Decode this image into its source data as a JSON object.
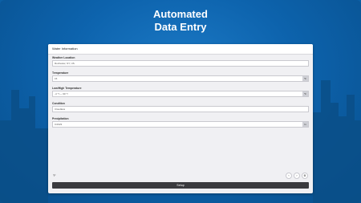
{
  "hero": {
    "line1": "Automated",
    "line2": "Data Entry"
  },
  "window": {
    "title": "Water Information"
  },
  "fields": [
    {
      "label": "Weather Location",
      "value": "Rochester, NY, US",
      "unit": ""
    },
    {
      "label": "Temperature",
      "value": "15",
      "unit": "°F"
    },
    {
      "label": "Low/High Temperature",
      "value": "-4 °f — 90 °f",
      "unit": "°F"
    },
    {
      "label": "Condition",
      "value": "Cloudless",
      "unit": ""
    },
    {
      "label": "Precipitation",
      "value": "0.0023",
      "unit": "In"
    }
  ],
  "footer": {
    "left_text": "°F",
    "prev_icon": "chevron-left-icon",
    "next_icon": "chevron-right-icon",
    "settings_icon": "gear-icon",
    "setup_label": "Setup"
  },
  "colors": {
    "background": "#0b5fa5",
    "skyline": "#0a4f88",
    "button": "#3a3a3e"
  }
}
